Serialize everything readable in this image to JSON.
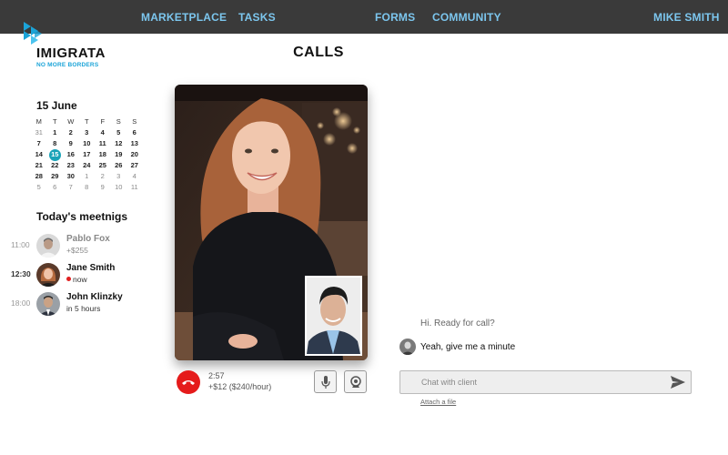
{
  "nav": {
    "marketplace": "MARKETPLACE",
    "tasks": "TASKS",
    "forms": "FORMS",
    "community": "COMMUNITY",
    "user": "MIKE SMITH"
  },
  "brand": {
    "name": "IMIGRATA",
    "tagline": "NO MORE BORDERS",
    "color": "#1ba4d8"
  },
  "page": {
    "title": "CALLS"
  },
  "calendar": {
    "date_label": "15 June",
    "weekdays": [
      "M",
      "T",
      "W",
      "T",
      "F",
      "S",
      "S"
    ],
    "weeks": [
      [
        "31",
        "1",
        "2",
        "3",
        "4",
        "5",
        "6"
      ],
      [
        "7",
        "8",
        "9",
        "10",
        "11",
        "12",
        "13"
      ],
      [
        "14",
        "15",
        "16",
        "17",
        "18",
        "19",
        "20"
      ],
      [
        "21",
        "22",
        "23",
        "24",
        "25",
        "26",
        "27"
      ],
      [
        "28",
        "29",
        "30",
        "1",
        "2",
        "3",
        "4"
      ],
      [
        "5",
        "6",
        "7",
        "8",
        "9",
        "10",
        "11"
      ]
    ],
    "today": "15",
    "accent": "#1aa3b8"
  },
  "meetings": {
    "title": "Today's meetnigs",
    "items": [
      {
        "time": "11:00",
        "name": "Pablo Fox",
        "sub": "+$255"
      },
      {
        "time": "12:30",
        "name": "Jane Smith",
        "sub": "now"
      },
      {
        "time": "18:00",
        "name": "John Klinzky",
        "sub": "in 5 hours"
      }
    ]
  },
  "call": {
    "duration": "2:57",
    "cost": "+$12 ($240/hour)",
    "hangup_icon": "phone-hangup-icon",
    "mic_icon": "microphone-icon",
    "camera_icon": "webcam-icon",
    "hangup_color": "#e51b1b"
  },
  "chat": {
    "messages": [
      {
        "text": "Hi. Ready for call?"
      },
      {
        "text": "Yeah, give me a minute"
      }
    ],
    "placeholder": "Chat with client",
    "attach_label": "Attach a file",
    "send_icon": "send-icon"
  }
}
